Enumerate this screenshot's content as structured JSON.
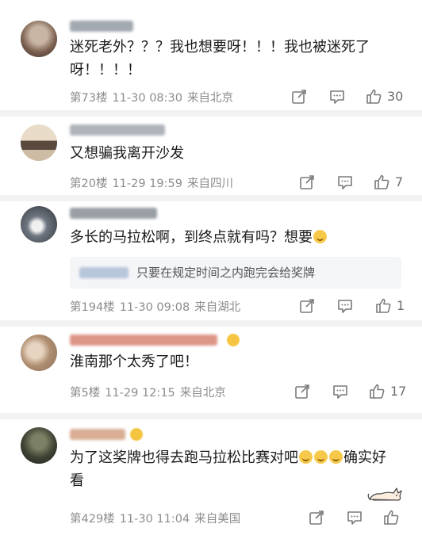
{
  "comments": [
    {
      "text": "迷死老外？？？我也想要呀！！！我也被迷死了呀！！！！",
      "floor": "第73楼",
      "time": "11-30 08:30",
      "location": "来自北京",
      "likes": "30",
      "avatar_color": "#8a6f5a"
    },
    {
      "text": "又想骗我离开沙发",
      "floor": "第20楼",
      "time": "11-29 19:59",
      "location": "来自四川",
      "likes": "7",
      "avatar_color": "#b9a58e"
    },
    {
      "text": "多长的马拉松啊，到终点就有吗？想要",
      "floor": "第194楼",
      "time": "11-30 09:08",
      "location": "来自湖北",
      "likes": "1",
      "reply_text": "只要在规定时间之内跑完会给奖牌",
      "avatar_color": "#6f7680"
    },
    {
      "text": "淮南那个太秀了吧！",
      "floor": "第5楼",
      "time": "11-29 12:15",
      "location": "来自北京",
      "likes": "17",
      "avatar_color": "#c7a88a"
    },
    {
      "text_before": "为了这奖牌也得去跑马拉松比赛对吧",
      "text_after": "确实好看",
      "floor": "第429楼",
      "time": "11-30 11:04",
      "location": "来自美国",
      "likes": "",
      "avatar_color": "#4a4f3c"
    }
  ],
  "icons": [
    "share-icon",
    "comment-icon",
    "like-icon",
    "laughing-emoji-icon",
    "grinning-emoji-icon",
    "cat-sticker-icon"
  ],
  "colors": {
    "text": "#1a1a1a",
    "meta": "#8c8c8c",
    "separator": "#f2f2f2",
    "reply_bg": "#f4f5f7"
  }
}
